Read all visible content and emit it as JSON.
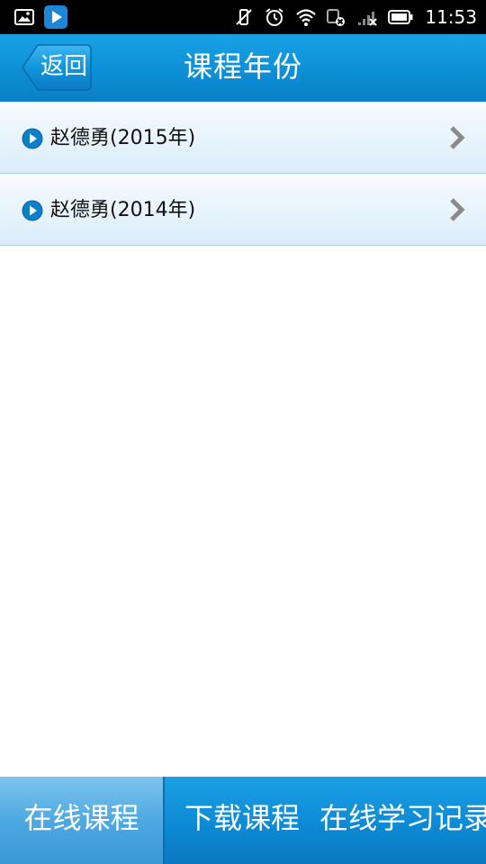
{
  "status_bar": {
    "time": "11:53",
    "left_icons": [
      "image-icon",
      "play-store-icon"
    ],
    "right_icons": [
      "vibrate-off-icon",
      "alarm-icon",
      "wifi-icon",
      "data-off-icon",
      "signal-icon",
      "battery-icon"
    ]
  },
  "header": {
    "title": "课程年份",
    "back_label": "返回"
  },
  "list": {
    "items": [
      {
        "label": "赵德勇(2015年)"
      },
      {
        "label": "赵德勇(2014年)"
      }
    ]
  },
  "tabs": [
    {
      "label": "在线课程",
      "active": true
    },
    {
      "label": "下载课程",
      "active": false
    },
    {
      "label": "在线学习记录",
      "active": false
    }
  ],
  "colors": {
    "header_blue": "#0c8fd6",
    "tab_active": "#4da9e2",
    "list_bg": "#e9f4fc",
    "bullet_blue": "#0b7fc7",
    "chevron_gray": "#8a8a8a"
  }
}
